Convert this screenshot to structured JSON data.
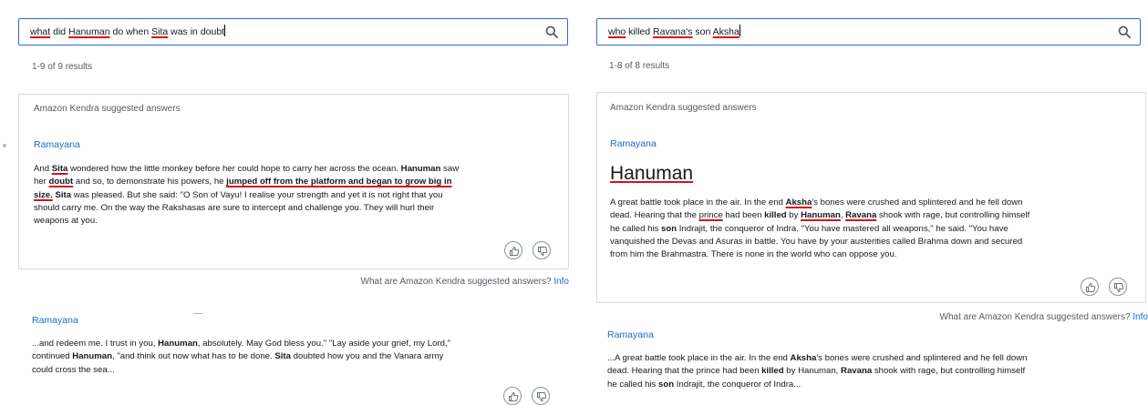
{
  "left": {
    "search": {
      "query_segments": [
        {
          "text": "what",
          "ul": true
        },
        {
          "text": " did ",
          "ul": false
        },
        {
          "text": "Hanuman",
          "ul": true
        },
        {
          "text": " do when ",
          "ul": false
        },
        {
          "text": "Sita",
          "ul": true
        },
        {
          "text": " was in doubt",
          "ul": false
        }
      ]
    },
    "result_count": "1-9 of 9 results",
    "suggested": {
      "title": "Amazon Kendra suggested answers",
      "doc_title": "Ramayana",
      "excerpt_lines": [
        [
          {
            "t": "And "
          },
          {
            "t": "Sita",
            "b": true,
            "ul": true
          },
          {
            "t": " wondered how the little monkey before her could hope to carry her across the ocean. "
          },
          {
            "t": "Hanuman",
            "b": true
          },
          {
            "t": " saw"
          }
        ],
        [
          {
            "t": "her "
          },
          {
            "t": "doubt",
            "b": true,
            "ul": true
          },
          {
            "t": " and so, to demonstrate his powers, he "
          },
          {
            "t": "jumped off from the platform and began to grow big in",
            "b": true,
            "ul": true
          }
        ],
        [
          {
            "t": "size.",
            "b": true,
            "ul": true
          },
          {
            "t": " "
          },
          {
            "t": "Sita",
            "b": true
          },
          {
            "t": " was pleased. But she said: \"O Son of Vayu! I realise your strength and yet it is not right that you"
          }
        ],
        [
          {
            "t": "should carry me. On the way the Rakshasas are sure to intercept and challenge you. They will hurl their"
          }
        ],
        [
          {
            "t": "weapons at you."
          }
        ]
      ],
      "footnote": "What are Amazon Kendra suggested answers?",
      "info": "Info"
    },
    "result": {
      "doc_title": "Ramayana",
      "excerpt_lines": [
        [
          {
            "t": "...and redeem me. I trust in you, "
          },
          {
            "t": "Hanuman",
            "b": true
          },
          {
            "t": ", absolutely. May God bless you.\" \"Lay aside your grief, my Lord,\""
          }
        ],
        [
          {
            "t": "continued "
          },
          {
            "t": "Hanuman",
            "b": true
          },
          {
            "t": ", \"and think out now what has to be done. "
          },
          {
            "t": "Sita",
            "b": true
          },
          {
            "t": " doubted how you and the Vanara army"
          }
        ],
        [
          {
            "t": "could cross the sea..."
          }
        ]
      ]
    }
  },
  "right": {
    "search": {
      "query_segments": [
        {
          "text": "who",
          "ul": true
        },
        {
          "text": " killed ",
          "ul": false
        },
        {
          "text": "Ravana's",
          "ul": true
        },
        {
          "text": " son ",
          "ul": false
        },
        {
          "text": "Aksha",
          "ul": true
        }
      ]
    },
    "result_count": "1-8 of 8 results",
    "suggested": {
      "title": "Amazon Kendra suggested answers",
      "doc_title": "Ramayana",
      "answer": "Hanuman",
      "excerpt_lines": [
        [
          {
            "t": "A great battle took place in the air. In the end "
          },
          {
            "t": "Aksha",
            "b": true,
            "ul": true
          },
          {
            "t": "'s bones were crushed and splintered and he fell down"
          }
        ],
        [
          {
            "t": "dead. Hearing that the "
          },
          {
            "t": "prince",
            "ul": true
          },
          {
            "t": " had been "
          },
          {
            "t": "killed",
            "b": true
          },
          {
            "t": " by "
          },
          {
            "t": "Hanuman",
            "b": true,
            "ul": true
          },
          {
            "t": ", "
          },
          {
            "t": "Ravana",
            "b": true,
            "ul": true
          },
          {
            "t": " shook with rage, but controlling himself"
          }
        ],
        [
          {
            "t": "he called his "
          },
          {
            "t": "son",
            "b": true
          },
          {
            "t": " Indrajit, the conqueror of Indra. \"You have mastered all weapons,\" he said. \"You have"
          }
        ],
        [
          {
            "t": "vanquished the Devas and Asuras in battle. You have by your austerities called Brahma down and secured"
          }
        ],
        [
          {
            "t": "from him the Brahmastra. There is none in the world who can oppose you."
          }
        ]
      ],
      "footnote": "What are Amazon Kendra suggested answers?",
      "info": "Info"
    },
    "result": {
      "doc_title": "Ramayana",
      "excerpt_lines": [
        [
          {
            "t": "...A great battle took place in the air. In the end "
          },
          {
            "t": "Aksha",
            "b": true
          },
          {
            "t": "'s bones were crushed and splintered and he fell down"
          }
        ],
        [
          {
            "t": "dead. Hearing that the prince had been "
          },
          {
            "t": "killed",
            "b": true
          },
          {
            "t": " by Hanuman, "
          },
          {
            "t": "Ravana",
            "b": true
          },
          {
            "t": " shook with rage, but controlling himself"
          }
        ],
        [
          {
            "t": "he called his "
          },
          {
            "t": "son",
            "b": true
          },
          {
            "t": " Indrajit, the conqueror of Indra..."
          }
        ]
      ]
    }
  },
  "colors": {
    "accent": "#2d6bd3",
    "link": "#1a6ec5",
    "highlight_underline": "#d7111c"
  },
  "icons": {
    "search": "search-icon",
    "thumbs_up": "thumbs-up-icon",
    "thumbs_down": "thumbs-down-icon"
  }
}
